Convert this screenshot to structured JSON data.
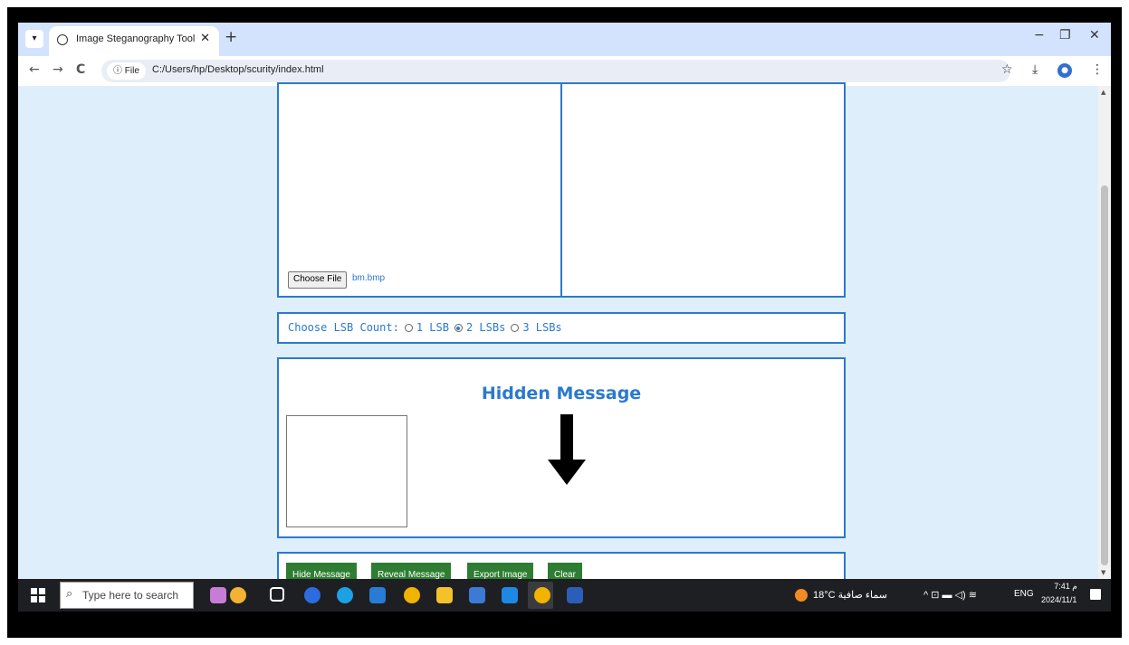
{
  "browser": {
    "tab_title": "Image Steganography Tool",
    "tab_close": "✕",
    "new_tab": "+",
    "window_controls": [
      "−",
      "❐",
      "✕"
    ],
    "back": "←",
    "forward": "→",
    "reload": "C",
    "site_chip": "ⓘ File",
    "url": "C:/Users/hp/Desktop/scurity/index.html",
    "toolbar_icons": [
      "star-icon",
      "download-icon",
      "profile-icon",
      "menu-icon"
    ]
  },
  "page": {
    "file_input": {
      "button_label": "Choose File",
      "file_name": "bm.bmp"
    },
    "lsb": {
      "label": "Choose LSB Count:",
      "options": [
        "1 LSB",
        "2 LSBs",
        "3 LSBs"
      ],
      "selected": "2 LSBs"
    },
    "hidden_message": {
      "title": "Hidden Message",
      "value": ""
    },
    "buttons": {
      "hide": "Hide Message",
      "reveal": "Reveal Message",
      "export": "Export Image",
      "clear": "Clear"
    },
    "annotation_arrow_color": "#000000",
    "accent_color": "#2a79d0",
    "button_color": "#2e7d32"
  },
  "taskbar": {
    "search_placeholder": "Type here to search",
    "weather": "18°C سماء صافية",
    "language": "ENG",
    "time": "7:41 م",
    "date": "2024/11/1"
  }
}
